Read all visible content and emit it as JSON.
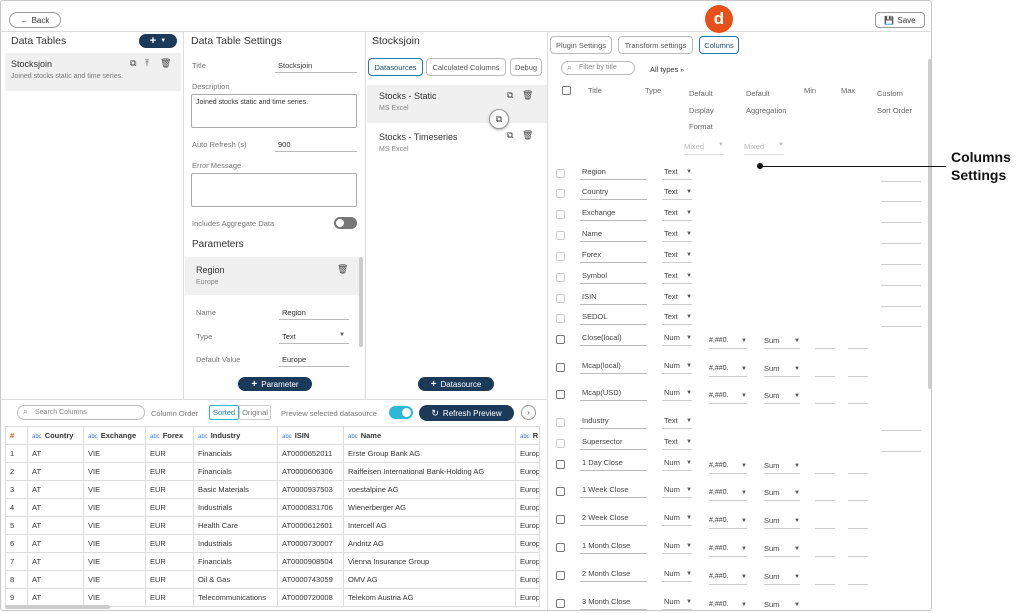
{
  "topbar": {
    "back_label": "Back",
    "save_label": "Save"
  },
  "data_tables": {
    "header": "Data Tables",
    "add_label": "+",
    "item": {
      "name": "Stocksjoin",
      "description": "Joined stocks static and time series."
    }
  },
  "settings": {
    "header": "Data Table Settings",
    "title_label": "Title",
    "title_value": "Stocksjoin",
    "description_label": "Description",
    "description_value": "Joined stocks static and time series.",
    "auto_refresh_label": "Auto Refresh (s)",
    "auto_refresh_value": "900",
    "error_label": "Error Message",
    "aggregate_label": "Includes Aggregate Data",
    "parameters_header": "Parameters",
    "param": {
      "name": "Region",
      "sub": "Europe",
      "name_label": "Name",
      "name_value": "Region",
      "type_label": "Type",
      "type_value": "Text",
      "default_label": "Default Value",
      "default_value": "Europe"
    },
    "add_param_label": "Parameter"
  },
  "stocksjoin": {
    "header": "Stocksjoin",
    "tabs": [
      "Datasources",
      "Calculated Columns",
      "Debug"
    ],
    "datasources": [
      {
        "name": "Stocks - Static",
        "type": "MS Excel"
      },
      {
        "name": "Stocks - Timeseries",
        "type": "MS Excel"
      }
    ],
    "add_ds_label": "Datasource"
  },
  "right": {
    "tabs": [
      "Plugin Settings",
      "Transform settings",
      "Columns"
    ],
    "badge": "d",
    "filter_placeholder": "Filter by title",
    "all_types": "All types",
    "headers": {
      "title": "Title",
      "type": "Type",
      "fmt1": "Default",
      "fmt2": "Display",
      "fmt3": "Format",
      "agg1": "Default",
      "agg2": "Aggregation",
      "min": "Min",
      "max": "Max",
      "sort1": "Custom",
      "sort2": "Sort Order"
    },
    "mixed": "Mixed",
    "columns": [
      {
        "title": "Region",
        "type": "Text",
        "numeric": false
      },
      {
        "title": "Country",
        "type": "Text",
        "numeric": false
      },
      {
        "title": "Exchange",
        "type": "Text",
        "numeric": false
      },
      {
        "title": "Name",
        "type": "Text",
        "numeric": false
      },
      {
        "title": "Forex",
        "type": "Text",
        "numeric": false
      },
      {
        "title": "Symbol",
        "type": "Text",
        "numeric": false
      },
      {
        "title": "ISIN",
        "type": "Text",
        "numeric": false
      },
      {
        "title": "SEDOL",
        "type": "Text",
        "numeric": false
      },
      {
        "title": "Close(local)",
        "type": "Num",
        "numeric": true,
        "fmt": "#,##0.",
        "agg": "Sum"
      },
      {
        "title": "Mcap(local)",
        "type": "Num",
        "numeric": true,
        "fmt": "#,##0.",
        "agg": "Sum"
      },
      {
        "title": "Mcap(USD)",
        "type": "Num",
        "numeric": true,
        "fmt": "#,##0.",
        "agg": "Sum"
      },
      {
        "title": "Industry",
        "type": "Text",
        "numeric": false
      },
      {
        "title": "Supersector",
        "type": "Text",
        "numeric": false
      },
      {
        "title": "1 Day Close",
        "type": "Num",
        "numeric": true,
        "fmt": "#,##0.",
        "agg": "Sum"
      },
      {
        "title": "1 Week Close",
        "type": "Num",
        "numeric": true,
        "fmt": "#,##0.",
        "agg": "Sum"
      },
      {
        "title": "2 Week Close",
        "type": "Num",
        "numeric": true,
        "fmt": "#,##0.",
        "agg": "Sum"
      },
      {
        "title": "1 Month Close",
        "type": "Num",
        "numeric": true,
        "fmt": "#,##0.",
        "agg": "Sum"
      },
      {
        "title": "2 Month Close",
        "type": "Num",
        "numeric": true,
        "fmt": "#,##0.",
        "agg": "Sum"
      },
      {
        "title": "3 Month Close",
        "type": "Num",
        "numeric": true,
        "fmt": "#,##0.",
        "agg": "Sum"
      }
    ]
  },
  "preview": {
    "search_placeholder": "Search Columns",
    "column_order_label": "Column Order",
    "sorted_label": "Sorted",
    "original_label": "Original",
    "preview_label": "Preview selected datasource",
    "refresh_label": "Refresh Preview",
    "hash": "#",
    "abc": "abc",
    "columns": [
      "Country",
      "Exchange",
      "Forex",
      "Industry",
      "ISIN",
      "Name",
      "R"
    ],
    "rows": [
      [
        "1",
        "AT",
        "VIE",
        "EUR",
        "Financials",
        "AT0000652011",
        "Erste Group Bank AG",
        "Europ"
      ],
      [
        "2",
        "AT",
        "VIE",
        "EUR",
        "Financials",
        "AT0000606306",
        "Raiffeisen International Bank-Holding AG",
        "Europ"
      ],
      [
        "3",
        "AT",
        "VIE",
        "EUR",
        "Basic Materials",
        "AT0000937503",
        "voestalpine AG",
        "Europ"
      ],
      [
        "4",
        "AT",
        "VIE",
        "EUR",
        "Industrials",
        "AT0000831706",
        "Wienerberger AG",
        "Europ"
      ],
      [
        "5",
        "AT",
        "VIE",
        "EUR",
        "Health Care",
        "AT0000612601",
        "Intercell AG",
        "Europ"
      ],
      [
        "6",
        "AT",
        "VIE",
        "EUR",
        "Industrials",
        "AT0000730007",
        "Andritz AG",
        "Europ"
      ],
      [
        "7",
        "AT",
        "VIE",
        "EUR",
        "Financials",
        "AT0000908504",
        "Vienna Insurance Group",
        "Europ"
      ],
      [
        "8",
        "AT",
        "VIE",
        "EUR",
        "Oil & Gas",
        "AT0000743059",
        "OMV AG",
        "Europ"
      ],
      [
        "9",
        "AT",
        "VIE",
        "EUR",
        "Telecommunications",
        "AT0000720008",
        "Telekom Austria AG",
        "Europ"
      ]
    ]
  },
  "callout": {
    "line1": "Columns",
    "line2": "Settings"
  },
  "colors": {
    "accent": "#1a7fa8",
    "navy": "#1b3a5a",
    "badge": "#e8501a",
    "toggle": "#2eb8d8"
  }
}
